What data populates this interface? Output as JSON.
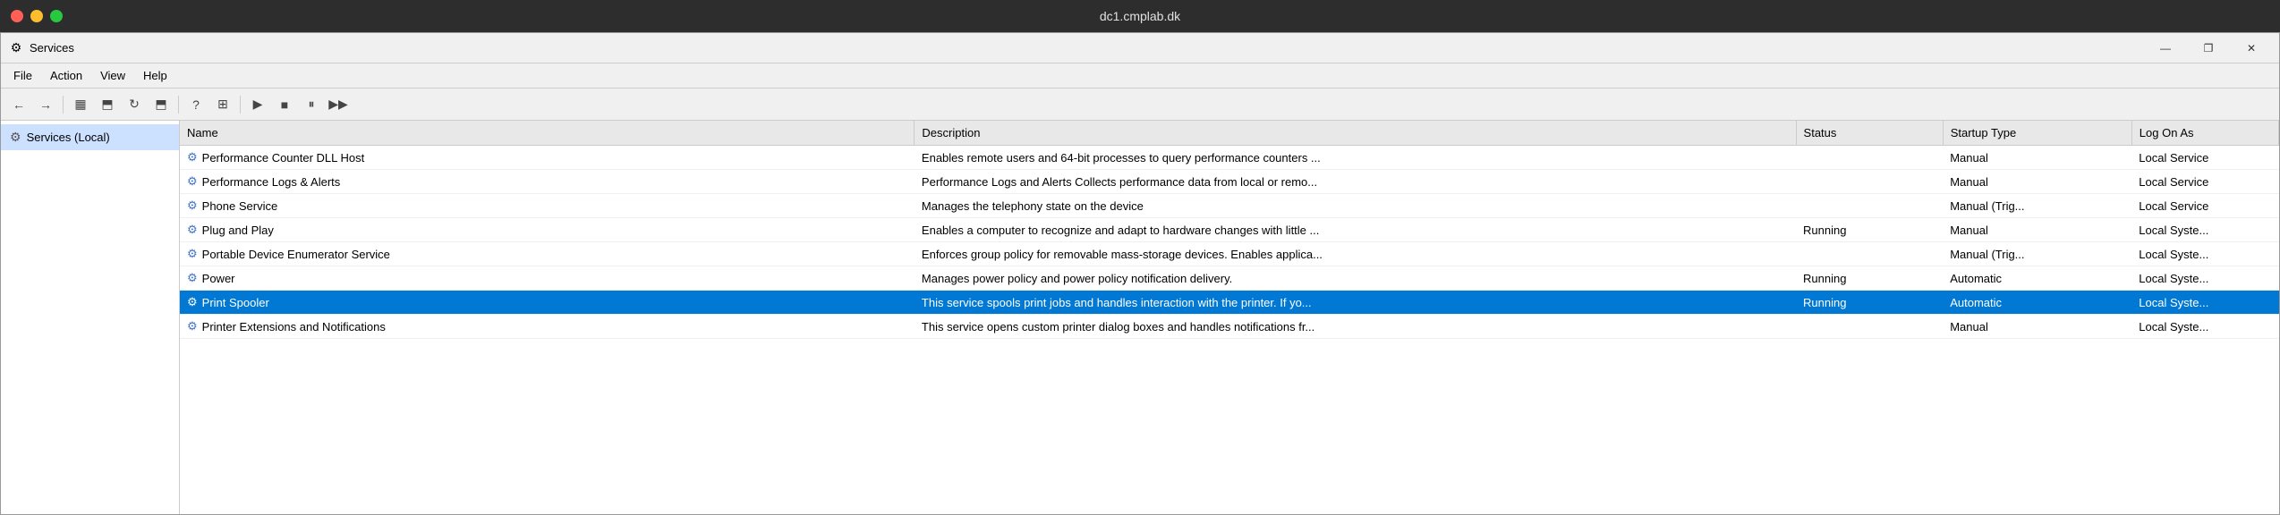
{
  "titlebar": {
    "title": "dc1.cmplab.dk"
  },
  "window": {
    "icon": "⚙",
    "title": "Services",
    "controls": {
      "minimize": "—",
      "maximize": "❐",
      "close": "✕"
    }
  },
  "menu": {
    "items": [
      "File",
      "Action",
      "View",
      "Help"
    ]
  },
  "toolbar": {
    "buttons": [
      {
        "name": "back",
        "symbol": "←"
      },
      {
        "name": "forward",
        "symbol": "→"
      },
      {
        "name": "show-console",
        "symbol": "▦"
      },
      {
        "name": "up",
        "symbol": "⬆"
      },
      {
        "name": "refresh",
        "symbol": "↻"
      },
      {
        "name": "export",
        "symbol": "⬒"
      },
      {
        "name": "properties",
        "symbol": "?"
      },
      {
        "name": "columns",
        "symbol": "⊞"
      },
      {
        "name": "play",
        "symbol": "▶"
      },
      {
        "name": "stop",
        "symbol": "■"
      },
      {
        "name": "pause",
        "symbol": "⏸"
      },
      {
        "name": "restart",
        "symbol": "▶▶"
      }
    ]
  },
  "sidebar": {
    "items": [
      {
        "label": "Services (Local)",
        "icon": "⚙",
        "selected": true
      }
    ]
  },
  "table": {
    "columns": [
      {
        "key": "name",
        "label": "Name"
      },
      {
        "key": "description",
        "label": "Description"
      },
      {
        "key": "status",
        "label": "Status"
      },
      {
        "key": "startupType",
        "label": "Startup Type"
      },
      {
        "key": "logOnAs",
        "label": "Log On As"
      }
    ],
    "rows": [
      {
        "name": "Performance Counter DLL Host",
        "description": "Enables remote users and 64-bit processes to query performance counters ...",
        "status": "",
        "startupType": "Manual",
        "logOnAs": "Local Service",
        "selected": false
      },
      {
        "name": "Performance Logs & Alerts",
        "description": "Performance Logs and Alerts Collects performance data from local or remo...",
        "status": "",
        "startupType": "Manual",
        "logOnAs": "Local Service",
        "selected": false
      },
      {
        "name": "Phone Service",
        "description": "Manages the telephony state on the device",
        "status": "",
        "startupType": "Manual (Trig...",
        "logOnAs": "Local Service",
        "selected": false
      },
      {
        "name": "Plug and Play",
        "description": "Enables a computer to recognize and adapt to hardware changes with little ...",
        "status": "Running",
        "startupType": "Manual",
        "logOnAs": "Local Syste...",
        "selected": false
      },
      {
        "name": "Portable Device Enumerator Service",
        "description": "Enforces group policy for removable mass-storage devices. Enables applica...",
        "status": "",
        "startupType": "Manual (Trig...",
        "logOnAs": "Local Syste...",
        "selected": false
      },
      {
        "name": "Power",
        "description": "Manages power policy and power policy notification delivery.",
        "status": "Running",
        "startupType": "Automatic",
        "logOnAs": "Local Syste...",
        "selected": false
      },
      {
        "name": "Print Spooler",
        "description": "This service spools print jobs and handles interaction with the printer.  If yo...",
        "status": "Running",
        "startupType": "Automatic",
        "logOnAs": "Local Syste...",
        "selected": true
      },
      {
        "name": "Printer Extensions and Notifications",
        "description": "This service opens custom printer dialog boxes and handles notifications fr...",
        "status": "",
        "startupType": "Manual",
        "logOnAs": "Local Syste...",
        "selected": false
      }
    ]
  },
  "colors": {
    "selected_bg": "#0078d4",
    "selected_text": "#ffffff",
    "header_bg": "#e8e8e8"
  }
}
